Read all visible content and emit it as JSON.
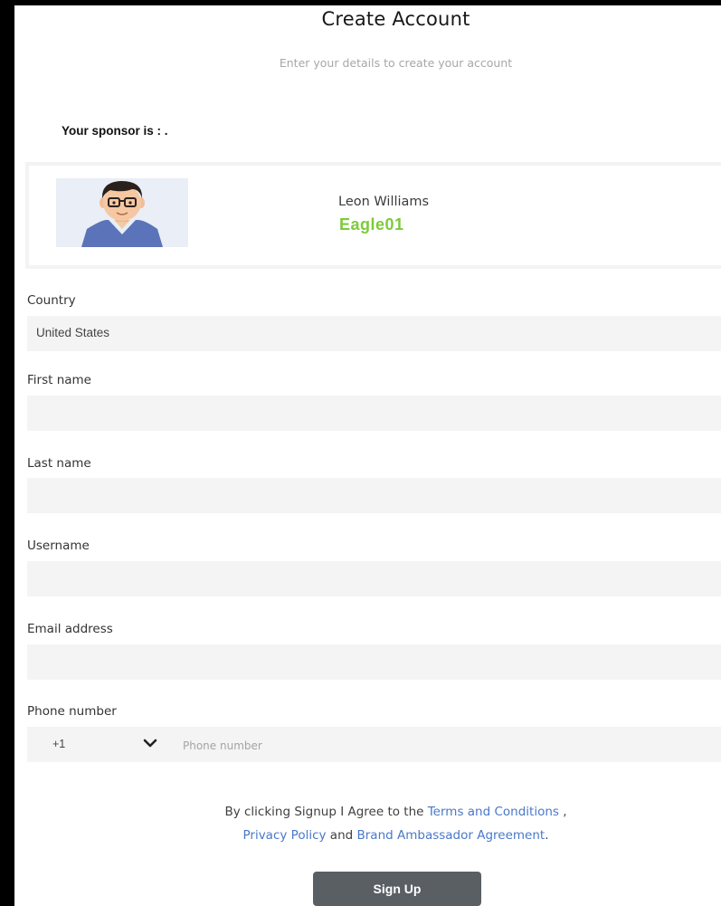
{
  "header": {
    "title": "Create Account",
    "subtitle": "Enter your details to create your account"
  },
  "sponsor": {
    "label": "Your sponsor is : .",
    "name": "Leon Williams",
    "code": "Eagle01",
    "code_color": "#7ccb3a",
    "avatar_icon": "user-avatar-illustration"
  },
  "form": {
    "country": {
      "label": "Country",
      "value": "United States"
    },
    "first_name": {
      "label": "First name",
      "value": ""
    },
    "last_name": {
      "label": "Last name",
      "value": ""
    },
    "username": {
      "label": "Username",
      "value": ""
    },
    "email": {
      "label": "Email address",
      "value": ""
    },
    "phone": {
      "label": "Phone number",
      "country_code": "+1",
      "placeholder": "Phone number",
      "dropdown_icon": "chevron-down-icon"
    }
  },
  "terms": {
    "prefix": "By clicking Signup I Agree to the ",
    "terms_link": "Terms and Conditions",
    "sep": " ,",
    "privacy_link": "Privacy Policy",
    "and": " and ",
    "agreement_link": "Brand Ambassador Agreement",
    "suffix": "."
  },
  "actions": {
    "signup_label": "Sign Up",
    "signup_color": "#5a5f63"
  }
}
